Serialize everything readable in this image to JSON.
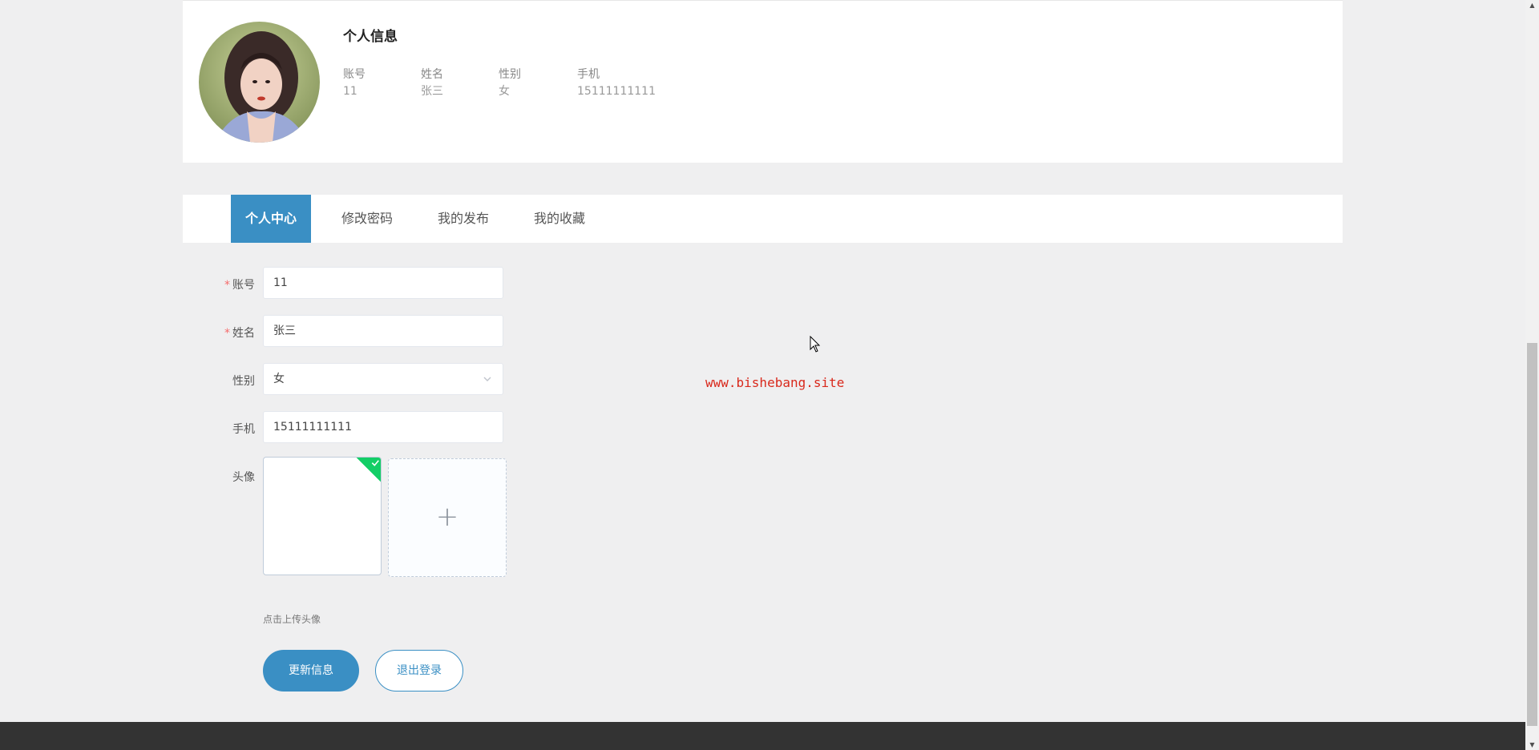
{
  "profile": {
    "title": "个人信息",
    "fields": [
      {
        "label": "账号",
        "value": "11"
      },
      {
        "label": "姓名",
        "value": "张三"
      },
      {
        "label": "性别",
        "value": "女"
      },
      {
        "label": "手机",
        "value": "15111111111"
      }
    ]
  },
  "tabs": [
    {
      "label": "个人中心",
      "active": true
    },
    {
      "label": "修改密码",
      "active": false
    },
    {
      "label": "我的发布",
      "active": false
    },
    {
      "label": "我的收藏",
      "active": false
    }
  ],
  "form": {
    "account": {
      "label": "账号",
      "value": "11",
      "required": "*"
    },
    "name": {
      "label": "姓名",
      "value": "张三",
      "required": "*"
    },
    "gender": {
      "label": "性别",
      "value": "女"
    },
    "phone": {
      "label": "手机",
      "value": "15111111111"
    },
    "avatar": {
      "label": "头像",
      "tip": "点击上传头像",
      "add_icon": "+"
    }
  },
  "buttons": {
    "update": "更新信息",
    "logout": "退出登录"
  },
  "watermark": "www.bishebang.site",
  "colors": {
    "accent": "#3a8fc4",
    "success": "#13ce66",
    "required": "#f56c6c",
    "watermark": "#d9291c",
    "footer": "#333333"
  }
}
